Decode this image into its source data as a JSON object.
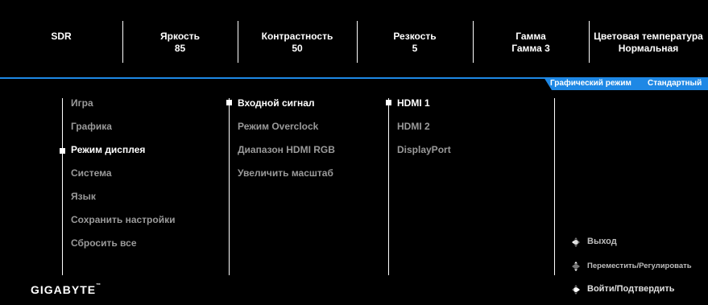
{
  "status": {
    "sdr": "SDR",
    "brightness_label": "Яркость",
    "brightness_value": "85",
    "contrast_label": "Контрастность",
    "contrast_value": "50",
    "sharpness_label": "Резкость",
    "sharpness_value": "5",
    "gamma_label": "Гамма",
    "gamma_value": "Гамма 3",
    "color_temp_label": "Цветовая температура",
    "color_temp_value": "Нормальная"
  },
  "mode_tab": {
    "label": "Графический режим",
    "value": "Стандартный"
  },
  "menu": {
    "main": [
      {
        "label": "Игра"
      },
      {
        "label": "Графика"
      },
      {
        "label": "Режим дисплея"
      },
      {
        "label": "Система"
      },
      {
        "label": "Язык"
      },
      {
        "label": "Сохранить настройки"
      },
      {
        "label": "Сбросить все"
      }
    ],
    "sub": [
      {
        "label": "Входной сигнал"
      },
      {
        "label": "Режим Overclock"
      },
      {
        "label": "Диапазон HDMI RGB"
      },
      {
        "label": "Увеличить масштаб"
      }
    ],
    "options": [
      {
        "label": "HDMI 1"
      },
      {
        "label": "HDMI 2"
      },
      {
        "label": "DisplayPort"
      }
    ]
  },
  "hints": {
    "exit": "Выход",
    "move_adjust": "Переместить/Регулировать",
    "enter_confirm": "Войти/Подтвердить"
  },
  "icons": {
    "joystick": "joystick-icon"
  },
  "colors": {
    "accent": "#1e88e5",
    "inactive_text": "#9a9a9a",
    "active_text": "#ffffff"
  },
  "brand": "GIGABYTE"
}
